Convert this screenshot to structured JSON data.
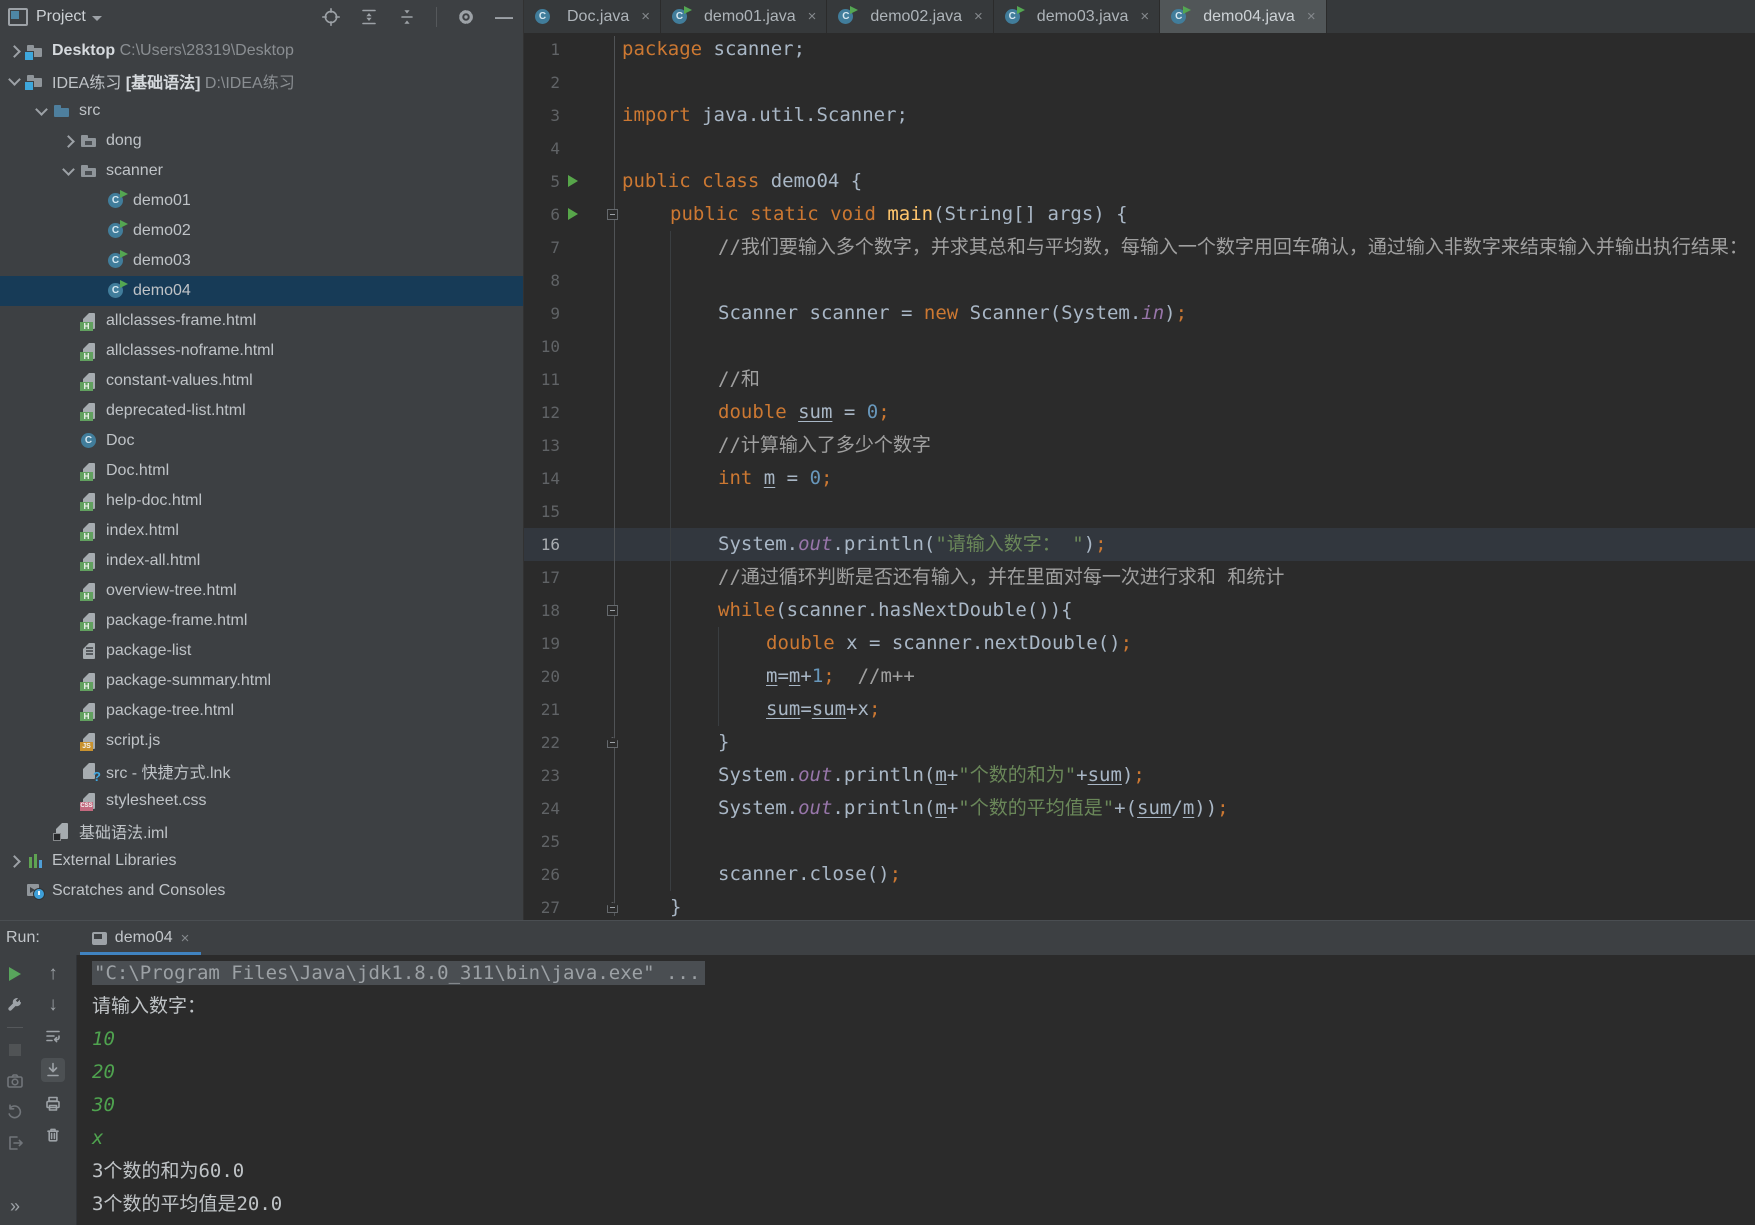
{
  "project_panel": {
    "title": "Project",
    "toolbar_icons": [
      "locate",
      "expand-all",
      "collapse-all",
      "divider",
      "settings",
      "hide"
    ]
  },
  "tree": [
    {
      "arrow": "r",
      "icon": "folder-badge",
      "level": 0,
      "parts": [
        {
          "t": "Desktop",
          "b": true
        },
        {
          "t": " C:\\Users\\28319\\Desktop",
          "d": true
        }
      ]
    },
    {
      "arrow": "d",
      "icon": "folder-badge",
      "level": 0,
      "parts": [
        {
          "t": "IDEA练习"
        },
        {
          "t": " [基础语法]",
          "b": true
        },
        {
          "t": " D:\\IDEA练习",
          "d": true
        }
      ]
    },
    {
      "arrow": "d",
      "icon": "folder-src",
      "level": 1,
      "parts": [
        {
          "t": "src"
        }
      ]
    },
    {
      "arrow": "r",
      "icon": "package",
      "level": 2,
      "parts": [
        {
          "t": "dong"
        }
      ]
    },
    {
      "arrow": "d",
      "icon": "package",
      "level": 2,
      "parts": [
        {
          "t": "scanner"
        }
      ]
    },
    {
      "arrow": "",
      "icon": "class-run",
      "level": 3,
      "parts": [
        {
          "t": "demo01"
        }
      ]
    },
    {
      "arrow": "",
      "icon": "class-run",
      "level": 3,
      "parts": [
        {
          "t": "demo02"
        }
      ]
    },
    {
      "arrow": "",
      "icon": "class-run",
      "level": 3,
      "parts": [
        {
          "t": "demo03"
        }
      ]
    },
    {
      "arrow": "",
      "icon": "class-run",
      "level": 3,
      "selected": true,
      "parts": [
        {
          "t": "demo04"
        }
      ]
    },
    {
      "arrow": "",
      "icon": "html",
      "level": 2,
      "parts": [
        {
          "t": "allclasses-frame.html"
        }
      ]
    },
    {
      "arrow": "",
      "icon": "html",
      "level": 2,
      "parts": [
        {
          "t": "allclasses-noframe.html"
        }
      ]
    },
    {
      "arrow": "",
      "icon": "html",
      "level": 2,
      "parts": [
        {
          "t": "constant-values.html"
        }
      ]
    },
    {
      "arrow": "",
      "icon": "html",
      "level": 2,
      "parts": [
        {
          "t": "deprecated-list.html"
        }
      ]
    },
    {
      "arrow": "",
      "icon": "class",
      "level": 2,
      "parts": [
        {
          "t": "Doc"
        }
      ]
    },
    {
      "arrow": "",
      "icon": "html",
      "level": 2,
      "parts": [
        {
          "t": "Doc.html"
        }
      ]
    },
    {
      "arrow": "",
      "icon": "html",
      "level": 2,
      "parts": [
        {
          "t": "help-doc.html"
        }
      ]
    },
    {
      "arrow": "",
      "icon": "html",
      "level": 2,
      "parts": [
        {
          "t": "index.html"
        }
      ]
    },
    {
      "arrow": "",
      "icon": "html",
      "level": 2,
      "parts": [
        {
          "t": "index-all.html"
        }
      ]
    },
    {
      "arrow": "",
      "icon": "html",
      "level": 2,
      "parts": [
        {
          "t": "overview-tree.html"
        }
      ]
    },
    {
      "arrow": "",
      "icon": "html",
      "level": 2,
      "parts": [
        {
          "t": "package-frame.html"
        }
      ]
    },
    {
      "arrow": "",
      "icon": "text",
      "level": 2,
      "parts": [
        {
          "t": "package-list"
        }
      ]
    },
    {
      "arrow": "",
      "icon": "html",
      "level": 2,
      "parts": [
        {
          "t": "package-summary.html"
        }
      ]
    },
    {
      "arrow": "",
      "icon": "html",
      "level": 2,
      "parts": [
        {
          "t": "package-tree.html"
        }
      ]
    },
    {
      "arrow": "",
      "icon": "js",
      "level": 2,
      "parts": [
        {
          "t": "script.js"
        }
      ]
    },
    {
      "arrow": "",
      "icon": "lnk",
      "level": 2,
      "parts": [
        {
          "t": "src - 快捷方式.lnk"
        }
      ]
    },
    {
      "arrow": "",
      "icon": "css",
      "level": 2,
      "parts": [
        {
          "t": "stylesheet.css"
        }
      ]
    },
    {
      "arrow": "",
      "icon": "iml",
      "level": 1,
      "parts": [
        {
          "t": "基础语法.iml"
        }
      ]
    },
    {
      "arrow": "r",
      "icon": "lib",
      "level": 0,
      "parts": [
        {
          "t": "External Libraries"
        }
      ]
    },
    {
      "arrow": "",
      "icon": "scratch",
      "level": 0,
      "parts": [
        {
          "t": "Scratches and Consoles"
        }
      ]
    }
  ],
  "tabs": [
    {
      "label": "Doc.java",
      "icon": "class",
      "close": "×",
      "active": false
    },
    {
      "label": "demo01.java",
      "icon": "class-run",
      "close": "×",
      "active": false
    },
    {
      "label": "demo02.java",
      "icon": "class-run",
      "close": "×",
      "active": false
    },
    {
      "label": "demo03.java",
      "icon": "class-run",
      "close": "×",
      "active": false
    },
    {
      "label": "demo04.java",
      "icon": "class-run",
      "close": "×",
      "active": true
    }
  ],
  "editor": {
    "lines": [
      {
        "n": 1,
        "i": 0,
        "g": "",
        "s": [
          [
            "k",
            "package"
          ],
          [
            "p",
            " scanner;"
          ]
        ]
      },
      {
        "n": 2,
        "i": 0,
        "g": "",
        "s": []
      },
      {
        "n": 3,
        "i": 0,
        "g": "",
        "s": [
          [
            "k",
            "import"
          ],
          [
            "p",
            " java.util.Scanner;"
          ]
        ]
      },
      {
        "n": 4,
        "i": 0,
        "g": "",
        "s": []
      },
      {
        "n": 5,
        "i": 0,
        "g": "run",
        "s": [
          [
            "k",
            "public class"
          ],
          [
            "p",
            " demo04 {"
          ]
        ]
      },
      {
        "n": 6,
        "i": 1,
        "g": "run fold",
        "s": [
          [
            "k",
            "public static void"
          ],
          [
            "m",
            " main"
          ],
          [
            "p",
            "(String[] args) {"
          ]
        ]
      },
      {
        "n": 7,
        "i": 2,
        "g": "",
        "s": [
          [
            "c",
            "//我们要输入多个数字，并求其总和与平均数，每输入一个数字用回车确认，通过输入非数字来结束输入并输出执行结果："
          ]
        ]
      },
      {
        "n": 8,
        "i": 2,
        "g": "",
        "s": []
      },
      {
        "n": 9,
        "i": 2,
        "g": "",
        "s": [
          [
            "p",
            "Scanner scanner = "
          ],
          [
            "k",
            "new"
          ],
          [
            "p",
            " Scanner(System."
          ],
          [
            "f",
            "in"
          ],
          [
            "p",
            ")"
          ],
          [
            "x",
            ";"
          ]
        ]
      },
      {
        "n": 10,
        "i": 2,
        "g": "",
        "s": []
      },
      {
        "n": 11,
        "i": 2,
        "g": "",
        "s": [
          [
            "c",
            "//和"
          ]
        ]
      },
      {
        "n": 12,
        "i": 2,
        "g": "",
        "s": [
          [
            "k",
            "double"
          ],
          [
            "p",
            " "
          ],
          [
            "u",
            "sum"
          ],
          [
            "p",
            " = "
          ],
          [
            "n",
            "0"
          ],
          [
            "x",
            ";"
          ]
        ]
      },
      {
        "n": 13,
        "i": 2,
        "g": "",
        "s": [
          [
            "c",
            "//计算输入了多少个数字"
          ]
        ]
      },
      {
        "n": 14,
        "i": 2,
        "g": "",
        "s": [
          [
            "k",
            "int"
          ],
          [
            "p",
            " "
          ],
          [
            "u",
            "m"
          ],
          [
            "p",
            " = "
          ],
          [
            "n",
            "0"
          ],
          [
            "x",
            ";"
          ]
        ]
      },
      {
        "n": 15,
        "i": 2,
        "g": "",
        "s": []
      },
      {
        "n": 16,
        "i": 2,
        "g": "",
        "cur": true,
        "s": [
          [
            "p",
            "System."
          ],
          [
            "f",
            "out"
          ],
          [
            "p",
            ".println("
          ],
          [
            "s2",
            "\"请输入数字： \""
          ],
          [
            "p",
            ")"
          ],
          [
            "x",
            ";"
          ]
        ]
      },
      {
        "n": 17,
        "i": 2,
        "g": "",
        "s": [
          [
            "c",
            "//通过循环判断是否还有输入，并在里面对每一次进行求和 和统计"
          ]
        ]
      },
      {
        "n": 18,
        "i": 2,
        "g": "fold",
        "s": [
          [
            "k",
            "while"
          ],
          [
            "p",
            "(scanner.hasNextDouble()){"
          ]
        ]
      },
      {
        "n": 19,
        "i": 3,
        "g": "",
        "s": [
          [
            "k",
            "double"
          ],
          [
            "p",
            " x = scanner.nextDouble()"
          ],
          [
            "x",
            ";"
          ]
        ]
      },
      {
        "n": 20,
        "i": 3,
        "g": "",
        "s": [
          [
            "u",
            "m"
          ],
          [
            "p",
            "="
          ],
          [
            "u",
            "m"
          ],
          [
            "p",
            "+"
          ],
          [
            "n",
            "1"
          ],
          [
            "x",
            ";"
          ],
          [
            "p",
            "  "
          ],
          [
            "c",
            "//m++"
          ]
        ]
      },
      {
        "n": 21,
        "i": 3,
        "g": "",
        "s": [
          [
            "u",
            "sum"
          ],
          [
            "p",
            "="
          ],
          [
            "u",
            "sum"
          ],
          [
            "p",
            "+x"
          ],
          [
            "x",
            ";"
          ]
        ]
      },
      {
        "n": 22,
        "i": 2,
        "g": "foldend",
        "s": [
          [
            "p",
            "}"
          ]
        ]
      },
      {
        "n": 23,
        "i": 2,
        "g": "",
        "s": [
          [
            "p",
            "System."
          ],
          [
            "f",
            "out"
          ],
          [
            "p",
            ".println("
          ],
          [
            "u",
            "m"
          ],
          [
            "p",
            "+"
          ],
          [
            "s2",
            "\"个数的和为\""
          ],
          [
            "p",
            "+"
          ],
          [
            "u",
            "sum"
          ],
          [
            "p",
            ")"
          ],
          [
            "x",
            ";"
          ]
        ]
      },
      {
        "n": 24,
        "i": 2,
        "g": "",
        "s": [
          [
            "p",
            "System."
          ],
          [
            "f",
            "out"
          ],
          [
            "p",
            ".println("
          ],
          [
            "u",
            "m"
          ],
          [
            "p",
            "+"
          ],
          [
            "s2",
            "\"个数的平均值是\""
          ],
          [
            "p",
            "+("
          ],
          [
            "u",
            "sum"
          ],
          [
            "p",
            "/"
          ],
          [
            "u",
            "m"
          ],
          [
            "p",
            "))"
          ],
          [
            "x",
            ";"
          ]
        ]
      },
      {
        "n": 25,
        "i": 2,
        "g": "",
        "s": []
      },
      {
        "n": 26,
        "i": 2,
        "g": "",
        "s": [
          [
            "p",
            "scanner.close()"
          ],
          [
            "x",
            ";"
          ]
        ]
      },
      {
        "n": 27,
        "i": 1,
        "g": "foldend",
        "s": [
          [
            "p",
            "}"
          ]
        ]
      }
    ]
  },
  "run_panel": {
    "label": "Run:",
    "tab_label": "demo04",
    "tab_close": "×",
    "left_toolbar": [
      "rerun",
      "wrench",
      "divider",
      "stop",
      "camera",
      "build",
      "exit"
    ],
    "left_toolbar_more": "»",
    "right_toolbar": [
      "up",
      "down",
      "soft-wrap",
      "scroll-end",
      "print",
      "clear"
    ],
    "console": [
      {
        "style": "sys",
        "selected": true,
        "text": "\"C:\\Program Files\\Java\\jdk1.8.0_311\\bin\\java.exe\" ..."
      },
      {
        "style": "out",
        "text": "请输入数字："
      },
      {
        "style": "in",
        "text": "10"
      },
      {
        "style": "in",
        "text": "20"
      },
      {
        "style": "in",
        "text": "30"
      },
      {
        "style": "in",
        "text": "x"
      },
      {
        "style": "out",
        "text": "3个数的和为60.0"
      },
      {
        "style": "out",
        "text": "3个数的平均值是20.0"
      }
    ]
  },
  "colors": {
    "keyword": "#CC7832",
    "string": "#6A8759",
    "number": "#6897BB",
    "field": "#9876AA",
    "method": "#FFC66D",
    "comment": "#A0A0A0",
    "plain": "#A9B7C6",
    "console_input": "#4FA34F",
    "tree_selection": "#173B57",
    "run_tab_accent": "#4083C0",
    "run_icon_green": "#57A64A"
  }
}
